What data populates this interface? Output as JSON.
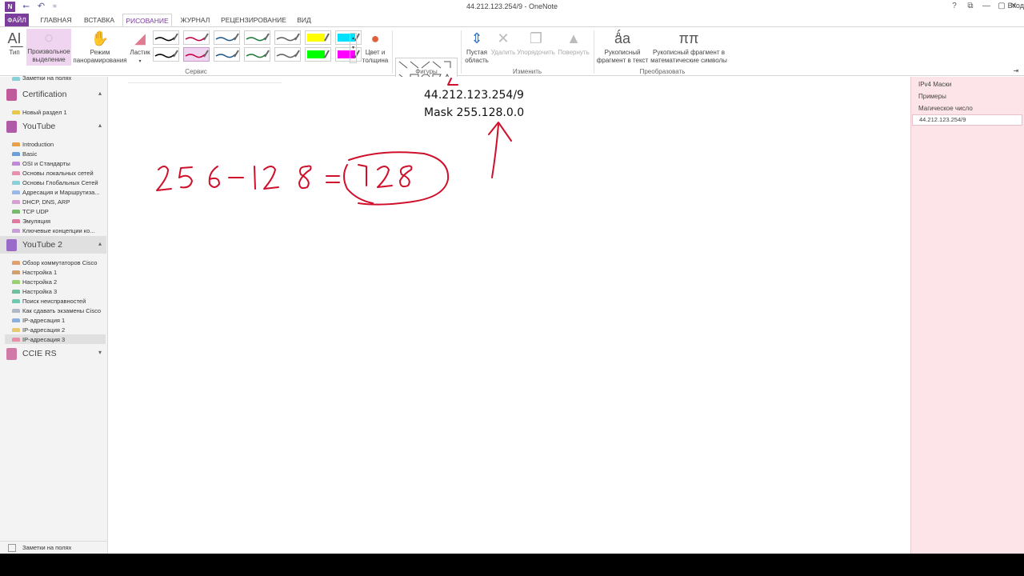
{
  "window": {
    "title": "44.212.123.254/9 - OneNote",
    "sign_in": "Вход",
    "logo": "N",
    "help": "?",
    "restore_ribbon": "⧉",
    "minimize": "—",
    "maximize": "▢",
    "close": "✕"
  },
  "quick_access": {
    "back": "⭠",
    "undo": "↶",
    "customize": "="
  },
  "tabs": {
    "file": "ФАЙЛ",
    "home": "ГЛАВНАЯ",
    "insert": "ВСТАВКА",
    "draw": "РИСОВАНИЕ",
    "history": "ЖУРНАЛ",
    "review": "РЕЦЕНЗИРОВАНИЕ",
    "view": "ВИД"
  },
  "ribbon": {
    "type_btn": "Тип",
    "lasso_l1": "Произвольное",
    "lasso_l2": "выделение",
    "pan_l1": "Режим",
    "pan_l2": "панорамирования",
    "eraser": "Ластик",
    "color_l1": "Цвет и",
    "color_l2": "толщина",
    "space_l1": "Пустая",
    "space_l2": "область",
    "delete": "Удалить",
    "arrange": "Упорядочить",
    "rotate": "Повернуть",
    "ink_text_l1": "Рукописный",
    "ink_text_l2": "фрагмент в текст",
    "ink_math_l1": "Рукописный фрагмент в",
    "ink_math_l2": "математические символы",
    "groups": {
      "tools": "Сервис",
      "shapes": "Фигуры",
      "edit": "Изменить",
      "convert": "Преобразовать"
    },
    "pen_colors": [
      "#000000",
      "#c00040",
      "#205a8a",
      "#1f7a3a",
      "#606060",
      "#ffff00",
      "#00e0ff",
      "#000000",
      "#c00040",
      "#205a8a",
      "#1f7a3a",
      "#606060",
      "#00ff00",
      "#ff00ff"
    ]
  },
  "nav": {
    "top_item": "Заметки на полях",
    "notebooks": [
      {
        "name": "Certification",
        "color": "#c05a9a",
        "sections": [
          {
            "label": "Новый раздел 1",
            "color": "#e8c84a"
          }
        ]
      },
      {
        "name": "YouTube",
        "color": "#b05aa8",
        "sections": [
          {
            "label": "Introduction",
            "color": "#e8a04a"
          },
          {
            "label": "Basic",
            "color": "#6aa0d8"
          },
          {
            "label": "OSI и Стандарты",
            "color": "#c08ad8"
          },
          {
            "label": "Основы локальных сетей",
            "color": "#e890b0"
          },
          {
            "label": "Основы Глобальных Сетей",
            "color": "#8ad0d8"
          },
          {
            "label": "Адресация и Маршрутиза...",
            "color": "#9ab8e8"
          },
          {
            "label": "DHCP, DNS, ARP",
            "color": "#d8a0d0"
          },
          {
            "label": "TCP UDP",
            "color": "#7ab870"
          },
          {
            "label": "Эмуляция",
            "color": "#e07aa0"
          },
          {
            "label": "Ключевые концепции ко...",
            "color": "#c8a0d8"
          }
        ]
      },
      {
        "name": "YouTube 2",
        "color": "#9a6ac8",
        "sections": [
          {
            "label": "Обзор коммутаторов Cisco",
            "color": "#e0a070"
          },
          {
            "label": "Настройка 1",
            "color": "#d0a070"
          },
          {
            "label": "Настройка 2",
            "color": "#9ad070"
          },
          {
            "label": "Настройка 3",
            "color": "#70c0a0"
          },
          {
            "label": "Поиск неисправностей",
            "color": "#70c8b0"
          },
          {
            "label": "Как сдавать экзамены Cisco",
            "color": "#b0b8c8"
          },
          {
            "label": "IP-адресация 1",
            "color": "#8ab0e0"
          },
          {
            "label": "IP-адресация 2",
            "color": "#e8c870"
          },
          {
            "label": "IP-адресация 3",
            "color": "#e890a8"
          }
        ]
      },
      {
        "name": "CCIE RS",
        "color": "#d07aa8",
        "sections": []
      }
    ],
    "footer": "Заметки на полях"
  },
  "page": {
    "line1": "44.212.123.254/9",
    "line2": "Mask 255.128.0.0"
  },
  "pages": {
    "items": [
      "IPv4 Маски",
      "Примеры",
      "Магическое число",
      "44.212.123.254/9"
    ],
    "selected_index": 3
  }
}
